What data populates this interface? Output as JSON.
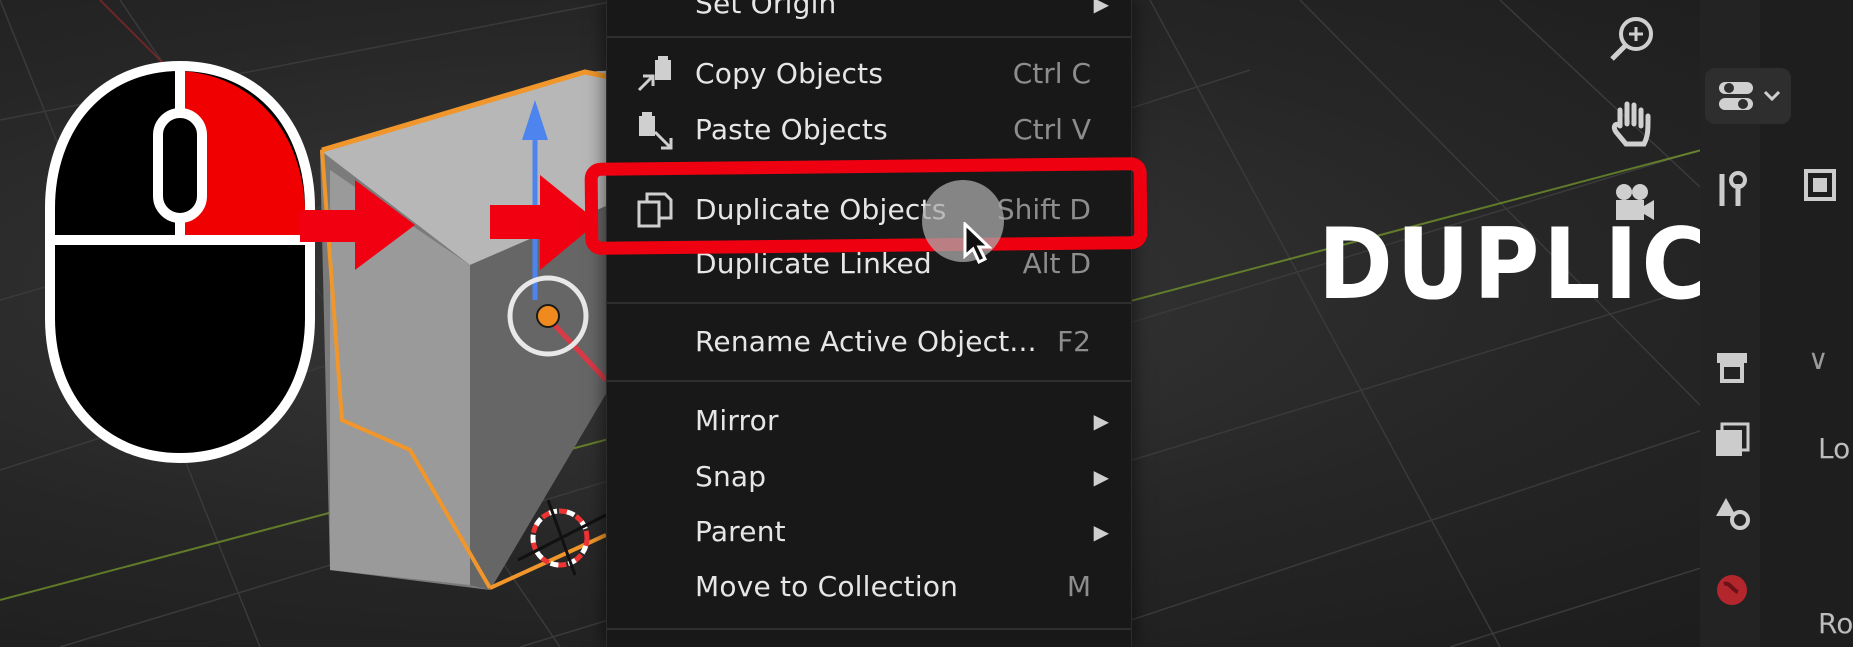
{
  "menu": {
    "items": [
      {
        "label": "Set Origin",
        "shortcut": "",
        "submenu": true
      },
      {
        "label": "Copy Objects",
        "shortcut": "Ctrl C",
        "icon": "copy-objects-icon"
      },
      {
        "label": "Paste Objects",
        "shortcut": "Ctrl V",
        "icon": "paste-objects-icon"
      },
      {
        "label": "Duplicate Objects",
        "shortcut": "Shift D",
        "icon": "duplicate-objects-icon"
      },
      {
        "label": "Duplicate Linked",
        "shortcut": "Alt D"
      },
      {
        "label": "Rename Active Object...",
        "shortcut": "F2"
      },
      {
        "label": "Mirror",
        "shortcut": "",
        "submenu": true
      },
      {
        "label": "Snap",
        "shortcut": "",
        "submenu": true
      },
      {
        "label": "Parent",
        "shortcut": "",
        "submenu": true
      },
      {
        "label": "Move to Collection",
        "shortcut": "M"
      }
    ],
    "submenu_arrow": "▶"
  },
  "overlay": {
    "title": "DUPLICATE",
    "mouse_button_highlighted": "right",
    "highlight_color": "#ee0010"
  },
  "sidebar": {
    "partial_labels": [
      "Lo",
      "Ro"
    ],
    "collapse_glyph": "∨"
  },
  "colors": {
    "selection_outline": "#f0962a",
    "menu_bg": "#181818",
    "grid_x_axis": "#9b2a2a",
    "grid_y_axis": "#7aa02b"
  }
}
